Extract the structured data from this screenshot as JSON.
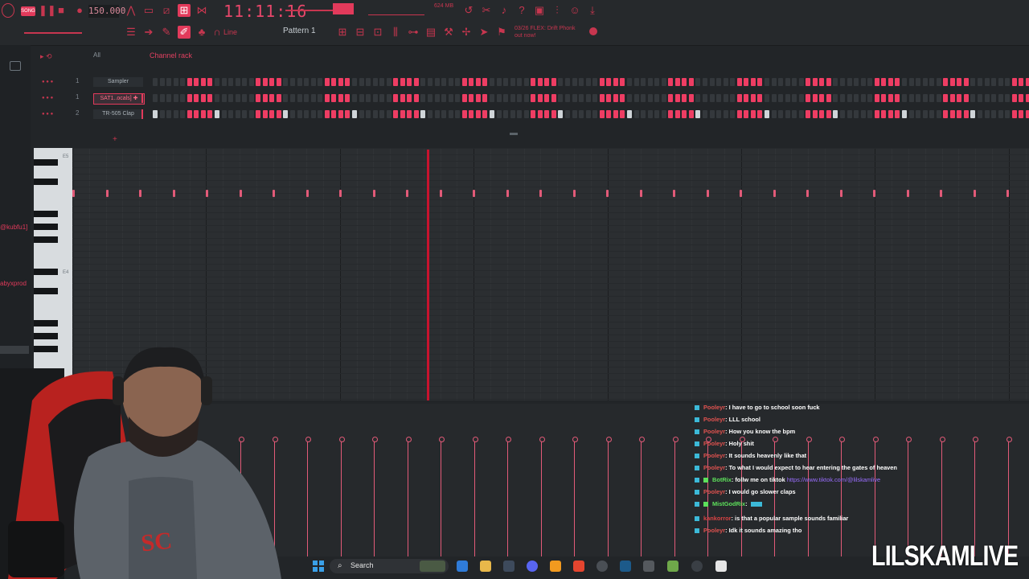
{
  "toolbar": {
    "song_badge": "SONG",
    "tempo": "150.000",
    "clock": "11:11:16",
    "memory": "624 MB",
    "pattern": "Pattern 1",
    "snap": "Line",
    "hint_line1": "03/26 FLEX: Drift Phonk",
    "hint_line2": "out now!"
  },
  "browser": {
    "user1": "@kubfu1]",
    "user2": "abyxprod"
  },
  "channel_rack": {
    "filter": "All",
    "title": "Channel rack",
    "channels": [
      {
        "num": "1",
        "name": "Sampler"
      },
      {
        "num": "1",
        "name": "SAT1..ocals] ✚"
      },
      {
        "num": "2",
        "name": "TR-505 Clap"
      }
    ]
  },
  "piano_roll": {
    "key_label_top": "E5",
    "key_label_mid": "E4"
  },
  "chat": {
    "messages": [
      {
        "user": "Pooleyr",
        "text": ": I have to go to school soon fuck"
      },
      {
        "user": "Pooleyr",
        "text": ": LLL school"
      },
      {
        "user": "Pooleyr",
        "text": ": How you know the bpm"
      },
      {
        "user": "Pooleyr",
        "text": ": Holy shit"
      },
      {
        "user": "Pooleyr",
        "text": ": It sounds heavenly like that"
      },
      {
        "user": "Pooleyr",
        "text": ": To what I would expect to hear entering the gates of heaven"
      },
      {
        "user": "BotRix",
        "text": ": follw me on tiktok ",
        "link": "https://www.tiktok.com/@lilskamlive"
      },
      {
        "user": "Pooleyr",
        "text": ": I would go slower claps"
      },
      {
        "user": "MistGodRix",
        "text": ":"
      },
      {
        "user": "kankorror",
        "text": ": is that a popular sample sounds familiar"
      },
      {
        "user": "Pooleyr",
        "text": ": Idk it sounds amazing tho"
      }
    ]
  },
  "taskbar": {
    "search": "Search"
  },
  "watermark": "LILSKAMLIVE",
  "colors": {
    "accent": "#e23a5b",
    "note": "#e25a78",
    "playhead": "#c8132e"
  }
}
